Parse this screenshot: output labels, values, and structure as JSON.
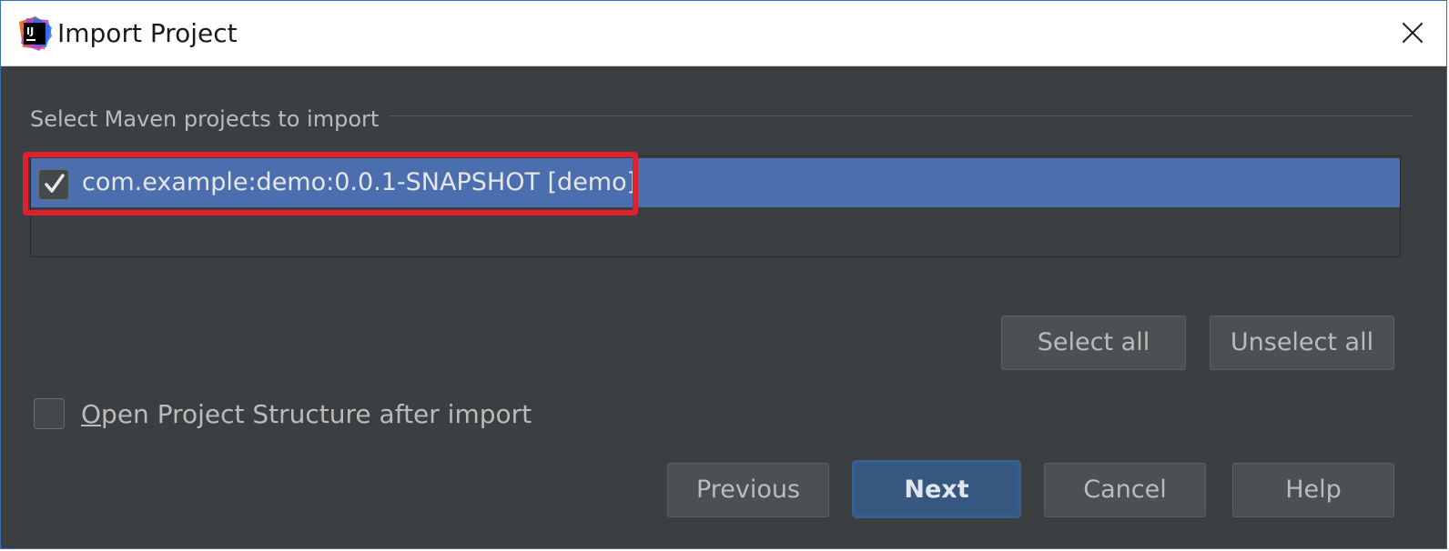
{
  "window": {
    "title": "Import Project",
    "app_icon_text": "IJ"
  },
  "maven": {
    "group_title": "Select Maven projects to import",
    "projects": [
      {
        "label": "com.example:demo:0.0.1-SNAPSHOT [demo]",
        "checked": true
      }
    ],
    "select_all_label": "Select all",
    "unselect_all_label": "Unselect all"
  },
  "options": {
    "open_structure_mnemonic": "O",
    "open_structure_rest": "pen Project Structure after import",
    "open_structure_checked": false
  },
  "footer": {
    "previous_label": "Previous",
    "next_label": "Next",
    "cancel_label": "Cancel",
    "help_label": "Help"
  },
  "colors": {
    "dialog_background": "#3c3f41",
    "selection": "#4b6eaf",
    "highlight_annotation": "#e0202a",
    "primary_button": "#365880"
  },
  "icons": {
    "app": "intellij-idea-icon",
    "close": "close-icon",
    "check": "checkmark-icon"
  }
}
